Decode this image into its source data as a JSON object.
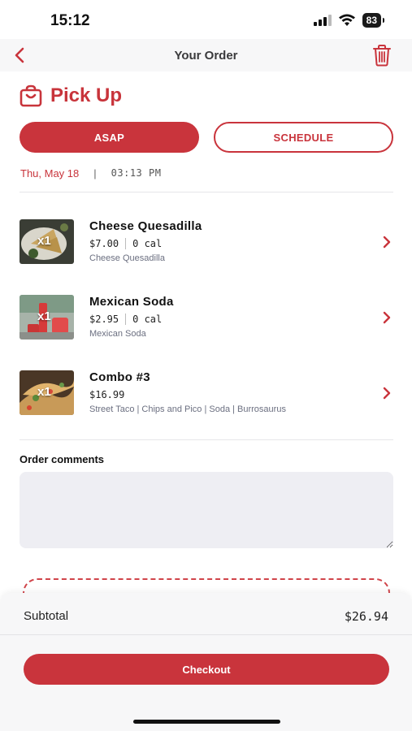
{
  "status": {
    "time": "15:12",
    "battery": "83"
  },
  "nav": {
    "title": "Your Order",
    "back_icon": "chevron-left-icon",
    "trash_icon": "trash-icon"
  },
  "pickup": {
    "title": "Pick Up",
    "icon": "shopping-bag-icon"
  },
  "timing": {
    "asap_label": "ASAP",
    "schedule_label": "SCHEDULE",
    "date": "Thu, May 18",
    "separator": "|",
    "time": "03:13 PM"
  },
  "items": [
    {
      "qty": "x1",
      "name": "Cheese Quesadilla",
      "price": "$7.00",
      "calories": "0 cal",
      "description": "Cheese Quesadilla"
    },
    {
      "qty": "x1",
      "name": "Mexican Soda",
      "price": "$2.95",
      "calories": "0 cal",
      "description": "Mexican Soda"
    },
    {
      "qty": "x1",
      "name": "Combo #3",
      "price": "$16.99",
      "calories": "",
      "description": "Street Taco | Chips and Pico | Soda | Burrosaurus"
    }
  ],
  "comments": {
    "label": "Order comments",
    "value": ""
  },
  "summary": {
    "subtotal_label": "Subtotal",
    "subtotal_value": "$26.94",
    "checkout_label": "Checkout"
  },
  "colors": {
    "accent": "#c9343c",
    "comment_bg": "#eeeef3",
    "desc_text": "#6b6f80"
  }
}
